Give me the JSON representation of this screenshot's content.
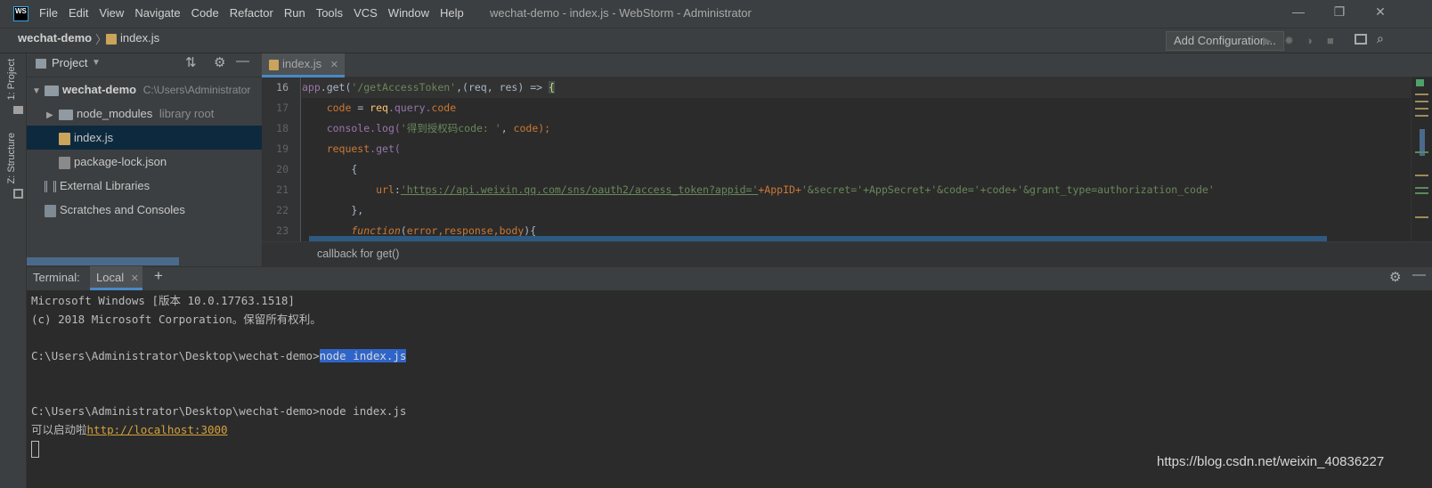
{
  "app": {
    "logo_text": "WS",
    "window_title": "wechat-demo - index.js - WebStorm - Administrator",
    "menu": [
      "File",
      "Edit",
      "View",
      "Navigate",
      "Code",
      "Refactor",
      "Run",
      "Tools",
      "VCS",
      "Window",
      "Help"
    ],
    "window_controls": {
      "minimize": "—",
      "restore": "❐",
      "close": "✕"
    }
  },
  "navbar": {
    "project": "wechat-demo",
    "separator": "〉",
    "file": "index.js",
    "add_config": "Add Configuration..."
  },
  "left_strip": {
    "project_tab": "1: Project",
    "structure_tab": "Z: Structure"
  },
  "project_panel": {
    "title": "Project",
    "tree": [
      {
        "name": "wechat-demo",
        "extra": "C:\\Users\\Administrator"
      },
      {
        "name": "node_modules",
        "extra": "library root"
      },
      {
        "name": "index.js"
      },
      {
        "name": "package-lock.json"
      },
      {
        "name": "External Libraries"
      },
      {
        "name": "Scratches and Consoles"
      }
    ]
  },
  "editor": {
    "tab": "index.js",
    "line_numbers": [
      "16",
      "17",
      "18",
      "19",
      "20",
      "21",
      "22",
      "23"
    ],
    "code_crumb": "callback for get()",
    "lines": [
      {
        "a": "app",
        "b": ".get(",
        "c": "'/getAccessToken'",
        "d": ",(req, res) => ",
        "e": "{"
      },
      {
        "a": "    code",
        "b": " = ",
        "c": "req",
        "d": ".query.",
        "e": "code"
      },
      {
        "a": "    console",
        "b": ".log(",
        "c": "'得到授权码code: '",
        "d": ", ",
        "e": "code);"
      },
      {
        "a": "    request",
        "b": ".get(",
        "c": "",
        "d": "",
        "e": ""
      },
      {
        "a": "        {",
        "b": "",
        "c": "",
        "d": "",
        "e": ""
      },
      {
        "a": "            url",
        "b": ":",
        "c": "'https://api.weixin.qq.com/sns/oauth2/access_token?appid='",
        "d": "+AppID+",
        "e": "'&secret='+AppSecret+'&code='+code+'&grant_type=authorization_code'"
      },
      {
        "a": "        },",
        "b": "",
        "c": "",
        "d": "",
        "e": ""
      },
      {
        "a": "        function",
        "b": "(",
        "c": "error,response,body",
        "d": "){",
        "e": ""
      }
    ]
  },
  "terminal": {
    "title": "Terminal:",
    "tab": "Local",
    "add": "+",
    "lines": [
      "Microsoft Windows [版本 10.0.17763.1518]",
      "(c) 2018 Microsoft Corporation。保留所有权利。",
      "C:\\Users\\Administrator\\Desktop\\wechat-demo>",
      "node index.js",
      "C:\\Users\\Administrator\\Desktop\\wechat-demo>node index.js",
      "可以启动啦",
      "http://localhost:3000"
    ]
  },
  "watermark": "https://blog.csdn.net/weixin_40836227"
}
